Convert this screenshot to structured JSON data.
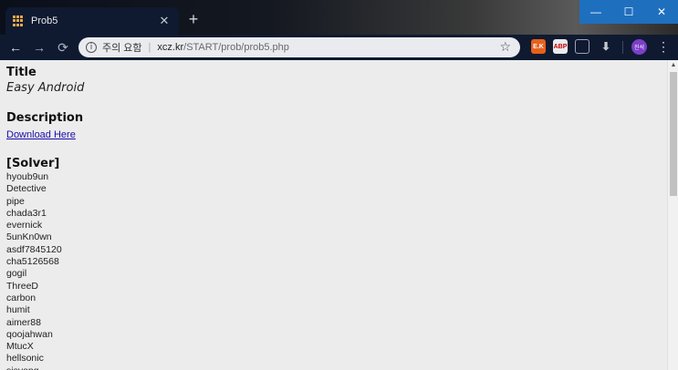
{
  "browser": {
    "tab": {
      "title": "Prob5"
    },
    "omnibox": {
      "security_label": "주의 요함",
      "url_host": "xcz.kr",
      "url_path": "/START/prob/prob5.php"
    },
    "extensions": [
      "E.K",
      "ABP",
      "",
      ""
    ],
    "avatar": "진석",
    "accent_color": "#1f6fbf"
  },
  "page": {
    "title_heading": "Title",
    "title_value": "Easy Android",
    "description_heading": "Description",
    "download_link": "Download Here",
    "solver_heading": "[Solver]",
    "solvers": [
      "hyoub9un",
      "Detective",
      "pipe",
      "chada3r1",
      "evernick",
      "5unKn0wn",
      "asdf7845120",
      "cha5126568",
      "gogil",
      "ThreeD",
      "carbon",
      "humit",
      "aimer88",
      "qoojahwan",
      "MtucX",
      "hellsonic",
      "sisyang"
    ]
  }
}
